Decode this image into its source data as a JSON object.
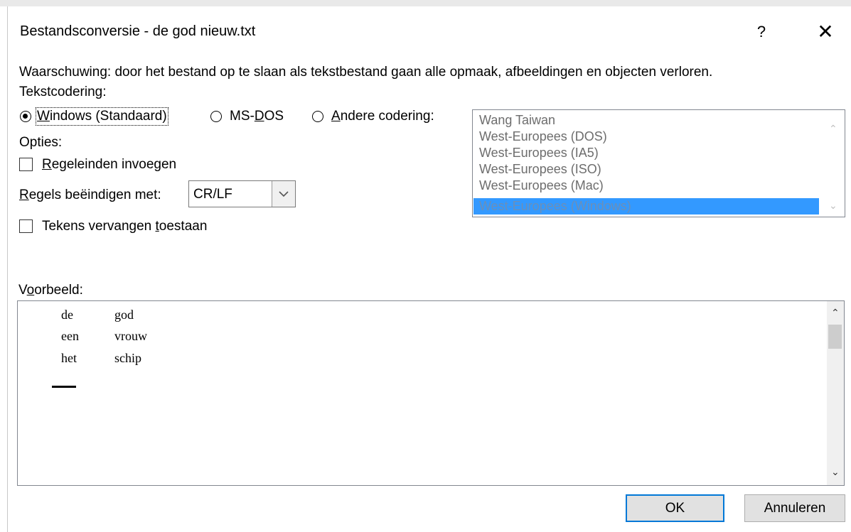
{
  "dialog": {
    "title": "Bestandsconversie - de god nieuw.txt",
    "help_label": "?",
    "close_label": "✕",
    "warning": "Waarschuwing: door het bestand op te slaan als tekstbestand gaan alle opmaak, afbeeldingen en objecten verloren."
  },
  "encoding": {
    "label": "Tekstcodering:",
    "options": [
      {
        "pre": "",
        "ul": "W",
        "post": "indows (Standaard)",
        "selected": true
      },
      {
        "pre": "MS-",
        "ul": "D",
        "post": "OS",
        "selected": false
      },
      {
        "pre": "",
        "ul": "A",
        "post": "ndere codering:",
        "selected": false
      }
    ],
    "list": [
      "Wang Taiwan",
      "West-Europees (DOS)",
      "West-Europees (IA5)",
      "West-Europees (ISO)",
      "West-Europees (Mac)",
      "West-Europees (Windows)"
    ],
    "list_selected": "West-Europees (Windows)"
  },
  "options": {
    "label": "Opties:",
    "insert_linebreaks": {
      "pre": "",
      "ul": "R",
      "post": "egeleinden invoegen",
      "checked": false
    },
    "end_lines": {
      "pre": "",
      "ul": "R",
      "post": "egels beëindigen met:",
      "value": "CR/LF"
    },
    "allow_substitution": {
      "pre": "Tekens vervangen ",
      "ul": "t",
      "post": "oestaan",
      "checked": false
    }
  },
  "preview": {
    "label_pre": "V",
    "label_ul": "o",
    "label_post": "orbeeld:",
    "rows": [
      [
        "de",
        "god"
      ],
      [
        "een",
        "vrouw"
      ],
      [
        "het",
        "schip"
      ]
    ]
  },
  "buttons": {
    "ok": "OK",
    "cancel": "Annuleren"
  },
  "colors": {
    "selection": "#3399ff",
    "default_button_border": "#0078d7"
  }
}
